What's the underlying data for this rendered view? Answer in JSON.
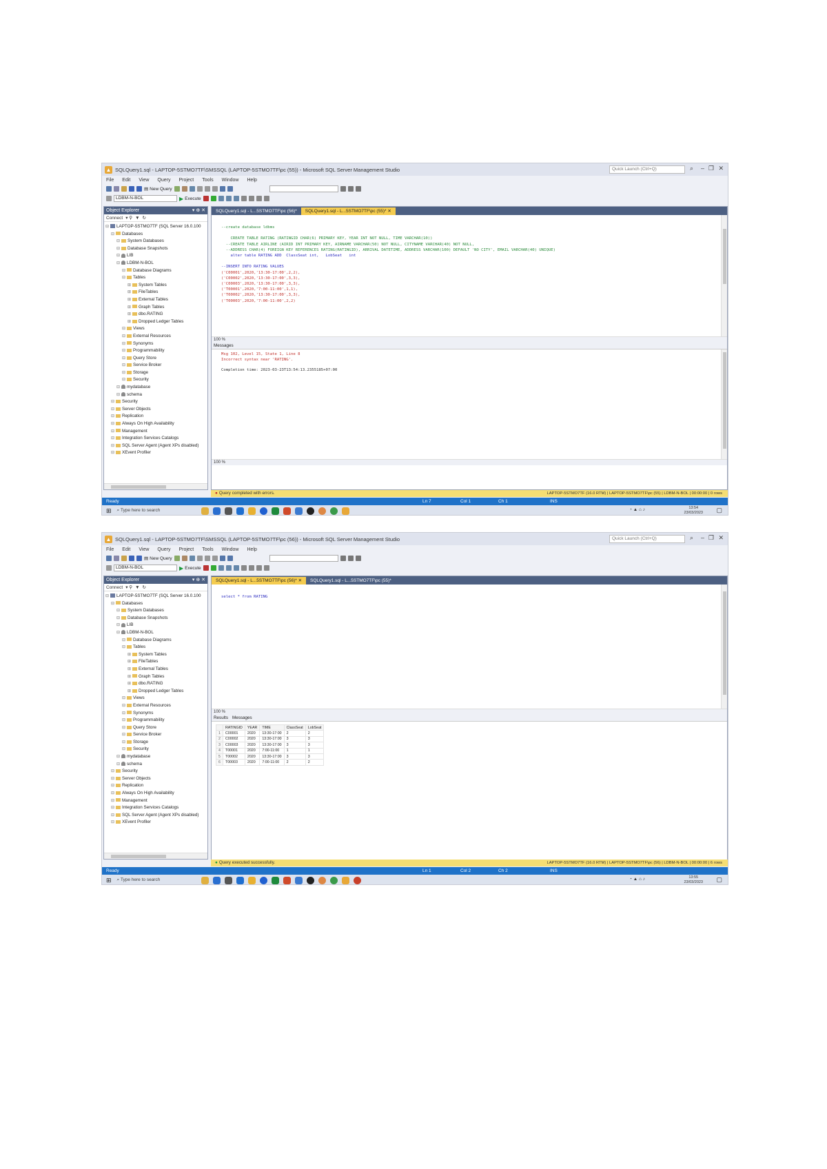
{
  "screenshot1": {
    "title": "SQLQuery1.sql - LAPTOP-5STMO7TF\\SMSSQL (LAPTOP-5STMO7TF\\pc (55)) - Microsoft SQL Server Management Studio",
    "quick_launch_placeholder": "Quick Launch (Ctrl+Q)",
    "menu": [
      "File",
      "Edit",
      "View",
      "Query",
      "Project",
      "Tools",
      "Window",
      "Help"
    ],
    "new_query_label": "New Query",
    "database_combo": "LDBM-N-BOL",
    "execute_label": "Execute",
    "object_explorer": {
      "title": "Object Explorer",
      "connect_label": "Connect",
      "tree": [
        {
          "level": 0,
          "icon": "server",
          "text": "LAPTOP-5STMO7TF (SQL Server 16.0.100"
        },
        {
          "level": 1,
          "icon": "folder",
          "text": "Databases"
        },
        {
          "level": 2,
          "icon": "folder",
          "text": "System Databases"
        },
        {
          "level": 2,
          "icon": "folder",
          "text": "Database Snapshots"
        },
        {
          "level": 2,
          "icon": "db",
          "text": "LIB"
        },
        {
          "level": 2,
          "icon": "db",
          "text": "LDBM-N-BOL"
        },
        {
          "level": 3,
          "icon": "folder",
          "text": "Database Diagrams"
        },
        {
          "level": 3,
          "icon": "folder",
          "text": "Tables"
        },
        {
          "level": 4,
          "icon": "folder",
          "text": "System Tables"
        },
        {
          "level": 4,
          "icon": "folder",
          "text": "FileTables"
        },
        {
          "level": 4,
          "icon": "folder",
          "text": "External Tables"
        },
        {
          "level": 4,
          "icon": "folder",
          "text": "Graph Tables"
        },
        {
          "level": 4,
          "icon": "table",
          "text": "dbo.RATING"
        },
        {
          "level": 4,
          "icon": "folder",
          "text": "Dropped Ledger Tables"
        },
        {
          "level": 3,
          "icon": "folder",
          "text": "Views"
        },
        {
          "level": 3,
          "icon": "folder",
          "text": "External Resources"
        },
        {
          "level": 3,
          "icon": "folder",
          "text": "Synonyms"
        },
        {
          "level": 3,
          "icon": "folder",
          "text": "Programmability"
        },
        {
          "level": 3,
          "icon": "folder",
          "text": "Query Store"
        },
        {
          "level": 3,
          "icon": "folder",
          "text": "Service Broker"
        },
        {
          "level": 3,
          "icon": "folder",
          "text": "Storage"
        },
        {
          "level": 3,
          "icon": "folder",
          "text": "Security"
        },
        {
          "level": 2,
          "icon": "db",
          "text": "mydatabase"
        },
        {
          "level": 2,
          "icon": "db",
          "text": "schema"
        },
        {
          "level": 1,
          "icon": "folder",
          "text": "Security"
        },
        {
          "level": 1,
          "icon": "folder",
          "text": "Server Objects"
        },
        {
          "level": 1,
          "icon": "folder",
          "text": "Replication"
        },
        {
          "level": 1,
          "icon": "folder",
          "text": "Always On High Availability"
        },
        {
          "level": 1,
          "icon": "folder",
          "text": "Management"
        },
        {
          "level": 1,
          "icon": "folder",
          "text": "Integration Services Catalogs"
        },
        {
          "level": 1,
          "icon": "agent",
          "text": "SQL Server Agent (Agent XPs disabled)"
        },
        {
          "level": 1,
          "icon": "folder",
          "text": "XEvent Profiler"
        }
      ]
    },
    "tabs": [
      "SQLQuery1.sql - L...5STMO7TF\\pc (56)*",
      "SQLQuery1.sql - L...5STMO7TF\\pc (55)*"
    ],
    "active_tab": 1,
    "code_lines": [
      {
        "cls": "grn",
        "text": "--create database ldbms"
      },
      {
        "cls": "",
        "text": ""
      },
      {
        "cls": "grn",
        "text": "    CREATE TABLE RATING (RATINGID CHAR(6) PRIMARY KEY, YEAR INT NOT NULL, TIME VARCHAR(10))"
      },
      {
        "cls": "grn",
        "text": "  --CREATE TABLE AIRLINE (AIRID INT PRIMARY KEY, AIRNAME VARCHAR(50) NOT NULL, CITYNAME VARCHAR(40) NOT NULL,"
      },
      {
        "cls": "grn",
        "text": "  --ADDRESS CHAR(4) FOREIGN KEY REFERENCES RATING(RATINGID), ARRIVAL DATETIME, ADDRESS VARCHAR(100) DEFAULT 'NO CITY', EMAIL VARCHAR(40) UNIQUE)"
      },
      {
        "cls": "",
        "text": "    alter table RATING ADD  ClassSeat int,   LobSeat   int"
      },
      {
        "cls": "",
        "text": ""
      },
      {
        "cls": "",
        "text": "--INSERT INTO RATING VALUES"
      },
      {
        "cls": "red",
        "text": "('C00001',2020,'13:30-17:00',2,2),"
      },
      {
        "cls": "red",
        "text": "('C00002',2020,'13:30-17:00',3,3),"
      },
      {
        "cls": "red",
        "text": "('C00003',2020,'13:30-17:00',3,3),"
      },
      {
        "cls": "red",
        "text": "('T00001',2020,'7:00-11:00',1,1),"
      },
      {
        "cls": "red",
        "text": "('T00002',2020,'13:30-17:00',3,3),"
      },
      {
        "cls": "red",
        "text": "('T00003',2020,'7:00-11:00',2,2)"
      }
    ],
    "zoom": "100 %",
    "results_tab": "Messages",
    "messages": [
      {
        "cls": "",
        "text": "Msg 102, Level 15, State 1, Line 8"
      },
      {
        "cls": "",
        "text": "Incorrect syntax near 'RATING'."
      },
      {
        "cls": "",
        "text": ""
      },
      {
        "cls": "blk",
        "text": "Completion time: 2023-03-23T13:54:13.2355185+07:00"
      }
    ],
    "query_status": "Query completed with errors.",
    "query_status_right": "LAPTOP-5STMO7TF (16.0 RTM) | LAPTOP-5STMO7TF\\pc (55) | LDBM-N-BOL | 00:00:00 | 0 rows",
    "app_status": "Ready",
    "status_cells": [
      "Ln 7",
      "Col 1",
      "Ch 1",
      "INS"
    ],
    "taskbar_search": "Type here to search",
    "clock_time": "13:54",
    "clock_date": "23/03/2023"
  },
  "screenshot2": {
    "title": "SQLQuery1.sql - LAPTOP-5STMO7TF\\SMSSQL (LAPTOP-5STMO7TF\\pc (56)) - Microsoft SQL Server Management Studio",
    "quick_launch_placeholder": "Quick Launch (Ctrl+Q)",
    "menu": [
      "File",
      "Edit",
      "View",
      "Query",
      "Project",
      "Tools",
      "Window",
      "Help"
    ],
    "new_query_label": "New Query",
    "database_combo": "LDBM-N-BOL",
    "execute_label": "Execute",
    "object_explorer": {
      "title": "Object Explorer",
      "connect_label": "Connect",
      "tree": [
        {
          "level": 0,
          "icon": "server",
          "text": "LAPTOP-5STMO7TF (SQL Server 16.0.100"
        },
        {
          "level": 1,
          "icon": "folder",
          "text": "Databases"
        },
        {
          "level": 2,
          "icon": "folder",
          "text": "System Databases"
        },
        {
          "level": 2,
          "icon": "folder",
          "text": "Database Snapshots"
        },
        {
          "level": 2,
          "icon": "db",
          "text": "LIB"
        },
        {
          "level": 2,
          "icon": "db",
          "text": "LDBM-N-BOL"
        },
        {
          "level": 3,
          "icon": "folder",
          "text": "Database Diagrams"
        },
        {
          "level": 3,
          "icon": "folder",
          "text": "Tables"
        },
        {
          "level": 4,
          "icon": "folder",
          "text": "System Tables"
        },
        {
          "level": 4,
          "icon": "folder",
          "text": "FileTables"
        },
        {
          "level": 4,
          "icon": "folder",
          "text": "External Tables"
        },
        {
          "level": 4,
          "icon": "folder",
          "text": "Graph Tables"
        },
        {
          "level": 4,
          "icon": "table",
          "text": "dbo.RATING"
        },
        {
          "level": 4,
          "icon": "folder",
          "text": "Dropped Ledger Tables"
        },
        {
          "level": 3,
          "icon": "folder",
          "text": "Views"
        },
        {
          "level": 3,
          "icon": "folder",
          "text": "External Resources"
        },
        {
          "level": 3,
          "icon": "folder",
          "text": "Synonyms"
        },
        {
          "level": 3,
          "icon": "folder",
          "text": "Programmability"
        },
        {
          "level": 3,
          "icon": "folder",
          "text": "Query Store"
        },
        {
          "level": 3,
          "icon": "folder",
          "text": "Service Broker"
        },
        {
          "level": 3,
          "icon": "folder",
          "text": "Storage"
        },
        {
          "level": 3,
          "icon": "folder",
          "text": "Security"
        },
        {
          "level": 2,
          "icon": "db",
          "text": "mydatabase"
        },
        {
          "level": 2,
          "icon": "db",
          "text": "schema"
        },
        {
          "level": 1,
          "icon": "folder",
          "text": "Security"
        },
        {
          "level": 1,
          "icon": "folder",
          "text": "Server Objects"
        },
        {
          "level": 1,
          "icon": "folder",
          "text": "Replication"
        },
        {
          "level": 1,
          "icon": "folder",
          "text": "Always On High Availability"
        },
        {
          "level": 1,
          "icon": "folder",
          "text": "Management"
        },
        {
          "level": 1,
          "icon": "folder",
          "text": "Integration Services Catalogs"
        },
        {
          "level": 1,
          "icon": "agent",
          "text": "SQL Server Agent (Agent XPs disabled)"
        },
        {
          "level": 1,
          "icon": "folder",
          "text": "XEvent Profiler"
        }
      ]
    },
    "tabs": [
      "SQLQuery1.sql - L...5STMO7TF\\pc (56)*",
      "SQLQuery1.sql - L...5STMO7TF\\pc (55)*"
    ],
    "active_tab": 0,
    "code_lines": [
      {
        "cls": "",
        "text": "select * from RATING"
      }
    ],
    "zoom": "100 %",
    "results_tabs": [
      "Results",
      "Messages"
    ],
    "results_columns": [
      "",
      "RATINGID",
      "YEAR",
      "TIME",
      "ClassSeat",
      "LobSeat"
    ],
    "results_rows": [
      [
        "1",
        "C00001",
        "2020",
        "13:30-17:00",
        "2",
        "2"
      ],
      [
        "2",
        "C00002",
        "2020",
        "13:30-17:00",
        "3",
        "3"
      ],
      [
        "3",
        "C00003",
        "2020",
        "13:30-17:00",
        "3",
        "3"
      ],
      [
        "4",
        "T00001",
        "2020",
        "7:00-11:00",
        "1",
        "1"
      ],
      [
        "5",
        "T00002",
        "2020",
        "13:30-17:00",
        "3",
        "3"
      ],
      [
        "6",
        "T00003",
        "2020",
        "7:00-11:00",
        "2",
        "2"
      ]
    ],
    "query_status": "Query executed successfully.",
    "query_status_right": "LAPTOP-5STMO7TF (16.0 RTM) | LAPTOP-5STMO7TF\\pc (56) | LDBM-N-BOL | 00:00:00 | 6 rows",
    "app_status": "Ready",
    "status_cells": [
      "Ln 1",
      "Col 2",
      "Ch 2",
      "INS"
    ],
    "taskbar_search": "Type here to search",
    "clock_time": "13:55",
    "clock_date": "23/03/2023"
  },
  "colors": {
    "pane_header": "#4d6082",
    "active_tab": "#f5cc4f",
    "status_bar": "#1f72c8",
    "query_status_bar": "#f5de73"
  }
}
